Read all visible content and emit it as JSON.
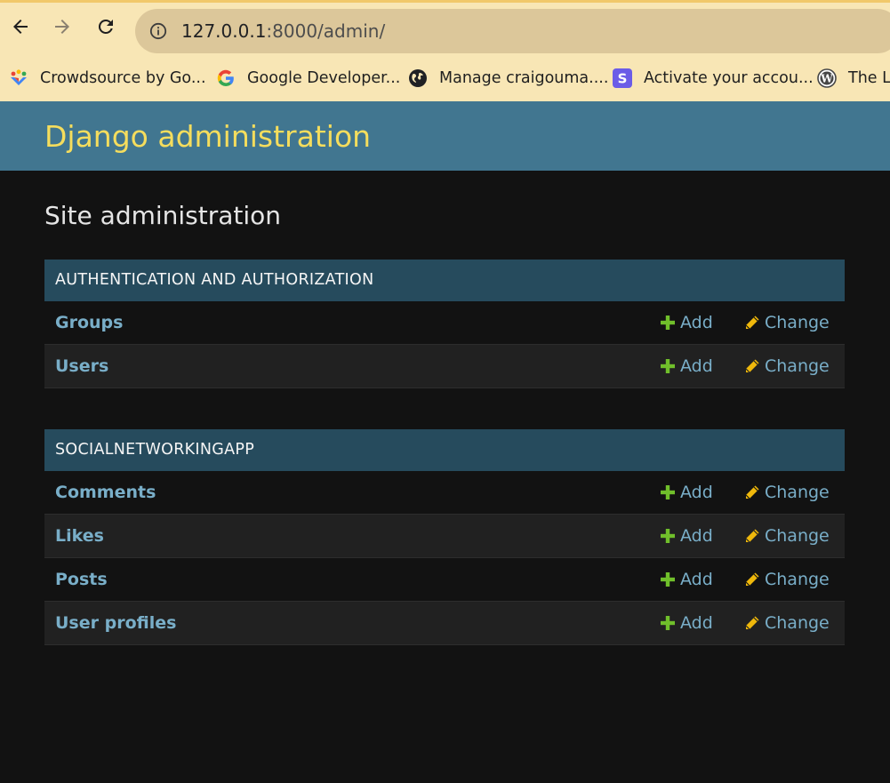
{
  "browser": {
    "url_host": "127.0.0.1",
    "url_rest": ":8000/admin/",
    "bookmarks": [
      {
        "label": "Crowdsource by Go...",
        "icon": "crowdsource-icon"
      },
      {
        "label": "Google Developer...",
        "icon": "google-icon"
      },
      {
        "label": "Manage craigouma....",
        "icon": "globe-icon"
      },
      {
        "label": "Activate your accou...",
        "icon": "s-logo-icon"
      },
      {
        "label": "The Lo",
        "icon": "wordpress-icon"
      }
    ]
  },
  "header": {
    "site_title": "Django administration"
  },
  "content": {
    "title": "Site administration",
    "modules": [
      {
        "caption": "AUTHENTICATION AND AUTHORIZATION",
        "models": [
          {
            "name": "Groups",
            "add": "Add",
            "change": "Change"
          },
          {
            "name": "Users",
            "add": "Add",
            "change": "Change"
          }
        ]
      },
      {
        "caption": "SOCIALNETWORKINGAPP",
        "models": [
          {
            "name": "Comments",
            "add": "Add",
            "change": "Change"
          },
          {
            "name": "Likes",
            "add": "Add",
            "change": "Change"
          },
          {
            "name": "Posts",
            "add": "Add",
            "change": "Change"
          },
          {
            "name": "User profiles",
            "add": "Add",
            "change": "Change"
          }
        ]
      }
    ]
  },
  "colors": {
    "header_bg": "#417690",
    "header_title": "#f5dd5d",
    "caption_bg": "#264b5d",
    "link": "#79aec8",
    "add_icon": "#70bf2b",
    "change_icon": "#efb80b"
  }
}
